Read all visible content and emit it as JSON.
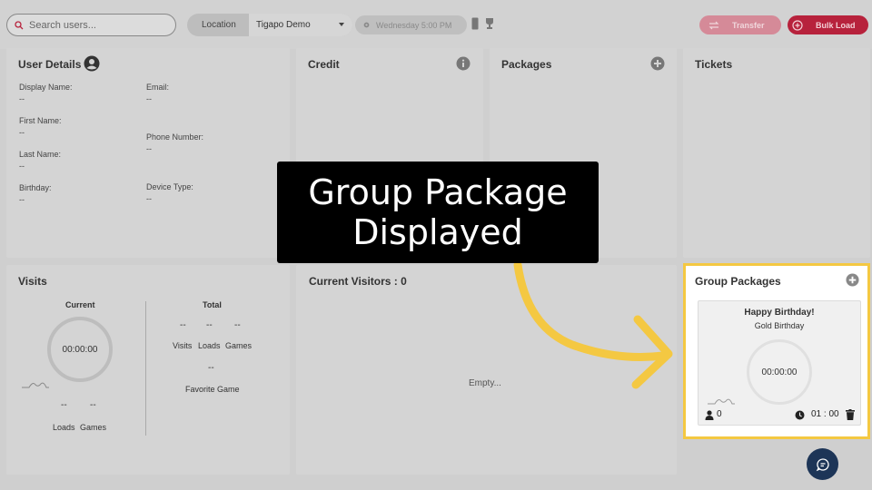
{
  "topbar": {
    "search": {
      "placeholder": "Search users..."
    },
    "location": {
      "label": "Location",
      "selected": "Tigapo Demo"
    },
    "datetime": "Wednesday 5:00 PM",
    "transfer_label": "Transfer",
    "bulk_load_label": "Bulk Load"
  },
  "user_details": {
    "title": "User Details",
    "fields": [
      {
        "label": "Display Name:",
        "value": "--"
      },
      {
        "label": "Email:",
        "value": "--"
      },
      {
        "label": "First Name:",
        "value": "--"
      },
      {
        "label": "Phone Number:",
        "value": "--"
      },
      {
        "label": "Last Name:",
        "value": "--"
      },
      {
        "label": "Birthday:",
        "value": "--"
      },
      {
        "label": "Device Type:",
        "value": "--"
      }
    ]
  },
  "credit": {
    "title": "Credit"
  },
  "packages": {
    "title": "Packages"
  },
  "tickets": {
    "title": "Tickets"
  },
  "visits": {
    "title": "Visits",
    "current": {
      "header": "Current",
      "timer": "00:00:00",
      "loads": "--",
      "games": "--",
      "loads_label": "Loads",
      "games_label": "Games"
    },
    "total": {
      "header": "Total",
      "visits": "--",
      "loads": "--",
      "games": "--",
      "visits_label": "Visits",
      "loads_label": "Loads",
      "games_label": "Games",
      "favorite": "--",
      "favorite_label": "Favorite Game"
    }
  },
  "current_visitors": {
    "title": "Current Visitors : 0",
    "empty": "Empty..."
  },
  "group_packages": {
    "title": "Group Packages",
    "item": {
      "name": "Happy Birthday!",
      "subtitle": "Gold Birthday",
      "timer": "00:00:00",
      "people": "0",
      "duration": "01 : 00"
    }
  },
  "overlay": {
    "line1": "Group Package",
    "line2": "Displayed"
  },
  "colors": {
    "highlight": "#f4c842",
    "bulk_load": "#b7223c",
    "transfer": "#d58a98",
    "chat": "#1d3557"
  }
}
